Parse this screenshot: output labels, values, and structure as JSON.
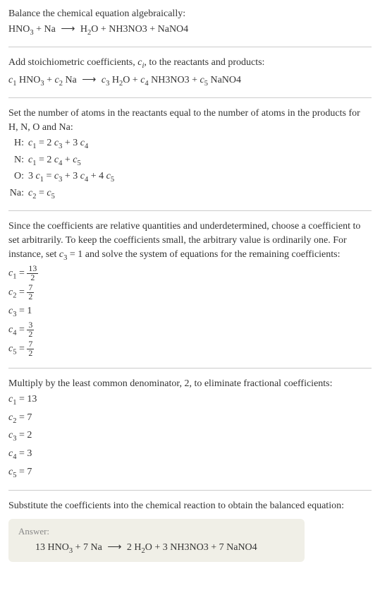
{
  "section1": {
    "title": "Balance the chemical equation algebraically:",
    "equation": "HNO₃ + Na ⟶ H₂O + NH3NO3 + NaNO4"
  },
  "section2": {
    "title_pre": "Add stoichiometric coefficients, ",
    "title_var": "cᵢ",
    "title_post": ", to the reactants and products:",
    "equation": "c₁ HNO₃ + c₂ Na ⟶ c₃ H₂O + c₄ NH3NO3 + c₅ NaNO4"
  },
  "section3": {
    "title": "Set the number of atoms in the reactants equal to the number of atoms in the products for H, N, O and Na:",
    "rows": [
      {
        "label": "H:",
        "eq": "c₁ = 2 c₃ + 3 c₄"
      },
      {
        "label": "N:",
        "eq": "c₁ = 2 c₄ + c₅"
      },
      {
        "label": "O:",
        "eq": "3 c₁ = c₃ + 3 c₄ + 4 c₅"
      },
      {
        "label": "Na:",
        "eq": "c₂ = c₅"
      }
    ]
  },
  "section4": {
    "title": "Since the coefficients are relative quantities and underdetermined, choose a coefficient to set arbitrarily. To keep the coefficients small, the arbitrary value is ordinarily one. For instance, set c₃ = 1 and solve the system of equations for the remaining coefficients:",
    "coefs": [
      {
        "lhs": "c₁ = ",
        "num": "13",
        "den": "2"
      },
      {
        "lhs": "c₂ = ",
        "num": "7",
        "den": "2"
      },
      {
        "lhs": "c₃ = ",
        "val": "1"
      },
      {
        "lhs": "c₄ = ",
        "num": "3",
        "den": "2"
      },
      {
        "lhs": "c₅ = ",
        "num": "7",
        "den": "2"
      }
    ]
  },
  "section5": {
    "title": "Multiply by the least common denominator, 2, to eliminate fractional coefficients:",
    "coefs": [
      {
        "line": "c₁ = 13"
      },
      {
        "line": "c₂ = 7"
      },
      {
        "line": "c₃ = 2"
      },
      {
        "line": "c₄ = 3"
      },
      {
        "line": "c₅ = 7"
      }
    ]
  },
  "section6": {
    "title": "Substitute the coefficients into the chemical reaction to obtain the balanced equation:",
    "answer_label": "Answer:",
    "answer": "13 HNO₃ + 7 Na ⟶ 2 H₂O + 3 NH3NO3 + 7 NaNO4"
  }
}
